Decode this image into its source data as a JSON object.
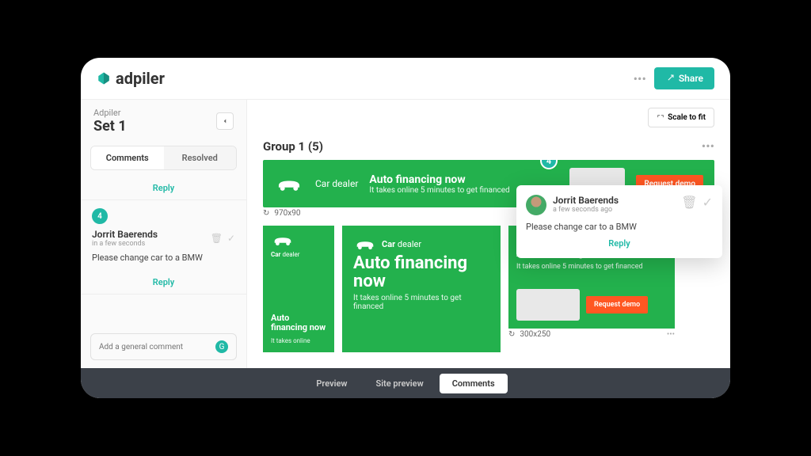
{
  "header": {
    "logo_text": "adpiler",
    "share_label": "Share"
  },
  "sidebar": {
    "brand": "Adpiler",
    "set_title": "Set 1",
    "tabs": {
      "comments": "Comments",
      "resolved": "Resolved"
    },
    "reply_top": "Reply",
    "comment": {
      "badge": "4",
      "author": "Jorrit Baerends",
      "time": "in a few seconds",
      "body": "Please change car to a BMW",
      "reply": "Reply"
    },
    "general_placeholder": "Add a general comment"
  },
  "main": {
    "scale_label": "Scale to fit",
    "group_title": "Group 1 (5)",
    "banner": {
      "brand": "Car",
      "brand_sub": "dealer",
      "title": "Auto financing now",
      "subtitle": "It takes online 5 minutes to get financed",
      "demo": "Request demo"
    },
    "sizes": {
      "wide": "970x90",
      "box": "300x250"
    },
    "banner2": {
      "title": "Auto financing now",
      "subtitle": "It takes online 5 minutes to get financed",
      "subtitle_short": "It takes online 5 minutes to get financed",
      "subtitle_tiny": "It takes online",
      "demo": "Request demo"
    },
    "marker": "4"
  },
  "popup": {
    "author": "Jorrit Baerends",
    "time": "a few seconds ago",
    "body": "Please change car to a BMW",
    "reply": "Reply"
  },
  "bottom": {
    "preview": "Preview",
    "site_preview": "Site preview",
    "comments": "Comments"
  }
}
